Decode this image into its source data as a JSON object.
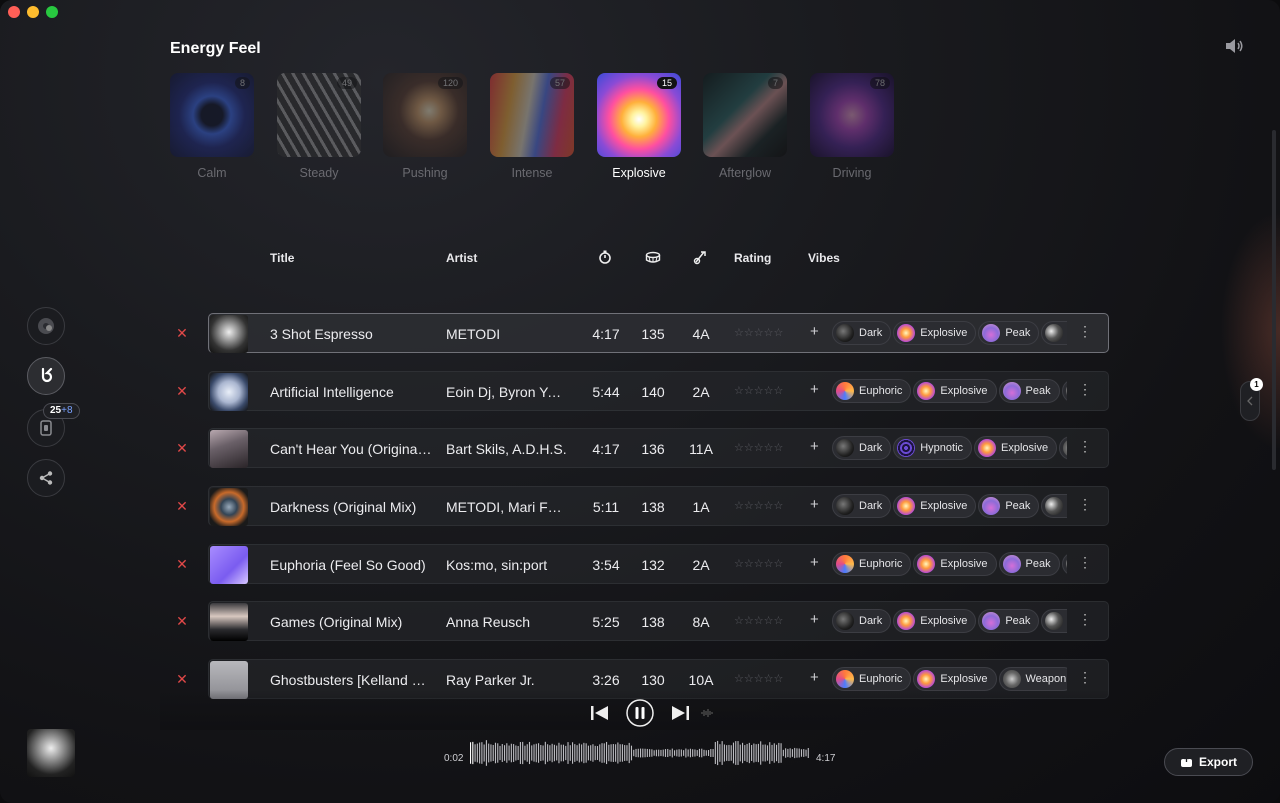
{
  "page": {
    "title": "Energy Feel"
  },
  "energy_levels": [
    {
      "label": "Calm",
      "count": "8",
      "active": false
    },
    {
      "label": "Steady",
      "count": "49",
      "active": false
    },
    {
      "label": "Pushing",
      "count": "120",
      "active": false
    },
    {
      "label": "Intense",
      "count": "57",
      "active": false
    },
    {
      "label": "Explosive",
      "count": "15",
      "active": true
    },
    {
      "label": "Afterglow",
      "count": "7",
      "active": false
    },
    {
      "label": "Driving",
      "count": "78",
      "active": false
    }
  ],
  "sidebar": {
    "badge_count": "25",
    "badge_plus": "+8"
  },
  "table": {
    "headers": {
      "title": "Title",
      "artist": "Artist",
      "rating": "Rating",
      "vibes": "Vibes"
    },
    "rows": [
      {
        "title": "3 Shot Espresso",
        "artist": "METODI",
        "time": "4:17",
        "bpm": "135",
        "key": "4A",
        "stars": "☆☆☆☆☆",
        "vibes": [
          {
            "label": "Dark",
            "icon": "dark"
          },
          {
            "label": "Explosive",
            "icon": "explosive"
          },
          {
            "label": "Peak",
            "icon": "peak"
          },
          {
            "label": "M",
            "icon": "moon"
          }
        ]
      },
      {
        "title": "Artificial Intelligence",
        "artist": "Eoin Dj, Byron Ye…",
        "time": "5:44",
        "bpm": "140",
        "key": "2A",
        "stars": "☆☆☆☆☆",
        "vibes": [
          {
            "label": "Euphoric",
            "icon": "euphoric"
          },
          {
            "label": "Explosive",
            "icon": "explosive"
          },
          {
            "label": "Peak",
            "icon": "peak"
          },
          {
            "label": "",
            "icon": "moon"
          }
        ]
      },
      {
        "title": "Can't Hear You (Original…",
        "artist": "Bart Skils, A.D.H.S.",
        "time": "4:17",
        "bpm": "136",
        "key": "11A",
        "stars": "☆☆☆☆☆",
        "vibes": [
          {
            "label": "Dark",
            "icon": "dark"
          },
          {
            "label": "Hypnotic",
            "icon": "hypnotic"
          },
          {
            "label": "Explosive",
            "icon": "explosive"
          },
          {
            "label": "",
            "icon": "weapon"
          }
        ]
      },
      {
        "title": "Darkness (Original Mix)",
        "artist": "METODI, Mari Fe…",
        "time": "5:11",
        "bpm": "138",
        "key": "1A",
        "stars": "☆☆☆☆☆",
        "vibes": [
          {
            "label": "Dark",
            "icon": "dark"
          },
          {
            "label": "Explosive",
            "icon": "explosive"
          },
          {
            "label": "Peak",
            "icon": "peak"
          },
          {
            "label": "M",
            "icon": "moon"
          }
        ]
      },
      {
        "title": "Euphoria (Feel So Good)",
        "artist": "Kos:mo, sin:port",
        "time": "3:54",
        "bpm": "132",
        "key": "2A",
        "stars": "☆☆☆☆☆",
        "vibes": [
          {
            "label": "Euphoric",
            "icon": "euphoric"
          },
          {
            "label": "Explosive",
            "icon": "explosive"
          },
          {
            "label": "Peak",
            "icon": "peak"
          },
          {
            "label": "",
            "icon": "moon"
          }
        ]
      },
      {
        "title": "Games (Original Mix)",
        "artist": "Anna Reusch",
        "time": "5:25",
        "bpm": "138",
        "key": "8A",
        "stars": "☆☆☆☆☆",
        "vibes": [
          {
            "label": "Dark",
            "icon": "dark"
          },
          {
            "label": "Explosive",
            "icon": "explosive"
          },
          {
            "label": "Peak",
            "icon": "peak"
          },
          {
            "label": "M",
            "icon": "moon"
          }
        ]
      },
      {
        "title": "Ghostbusters [Kelland R…",
        "artist": "Ray Parker Jr.",
        "time": "3:26",
        "bpm": "130",
        "key": "10A",
        "stars": "☆☆☆☆☆",
        "vibes": [
          {
            "label": "Euphoric",
            "icon": "euphoric"
          },
          {
            "label": "Explosive",
            "icon": "explosive"
          },
          {
            "label": "Weapon",
            "icon": "weapon"
          }
        ]
      }
    ]
  },
  "player": {
    "elapsed": "0:02",
    "duration": "4:17",
    "progress": 0.01
  },
  "export": {
    "label": "Export"
  },
  "side_panel": {
    "badge": "1"
  },
  "colors": {
    "remove": "#e04848",
    "accent": "#7aa2ff"
  }
}
